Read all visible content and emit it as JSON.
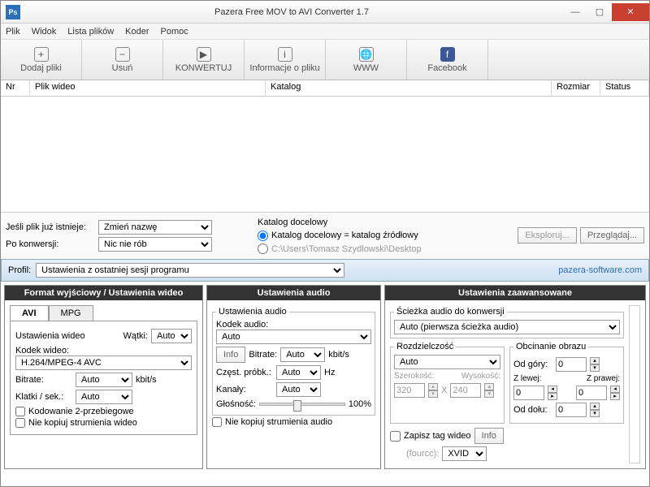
{
  "window": {
    "title": "Pazera Free MOV to AVI Converter 1.7"
  },
  "menu": [
    "Plik",
    "Widok",
    "Lista plików",
    "Koder",
    "Pomoc"
  ],
  "toolbar": [
    {
      "label": "Dodaj pliki",
      "icon": "+"
    },
    {
      "label": "Usuń",
      "icon": "−"
    },
    {
      "label": "KONWERTUJ",
      "icon": "▶"
    },
    {
      "label": "Informacje o pliku",
      "icon": "i"
    },
    {
      "label": "WWW",
      "icon": "🌐"
    },
    {
      "label": "Facebook",
      "icon": "f"
    }
  ],
  "columns": {
    "nr": "Nr",
    "plik": "Plik wideo",
    "katalog": "Katalog",
    "rozmiar": "Rozmiar",
    "status": "Status"
  },
  "opts": {
    "exists_label": "Jeśli plik już istnieje:",
    "exists_val": "Zmień nazwę",
    "after_label": "Po konwersji:",
    "after_val": "Nic nie rób",
    "dest_title": "Katalog docelowy",
    "dest_radio1": "Katalog docelowy = katalog źródłowy",
    "dest_radio2": "C:\\Users\\Tomasz Szydlowski\\Desktop",
    "eksploruj": "Eksploruj...",
    "przegladaj": "Przeglądaj..."
  },
  "profil": {
    "label": "Profil:",
    "value": "Ustawienia z ostatniej sesji programu",
    "link": "pazera-software.com"
  },
  "panel1": {
    "title": "Format wyjściowy / Ustawienia wideo",
    "tab_avi": "AVI",
    "tab_mpg": "MPG",
    "ust": "Ustawienia wideo",
    "watki": "Wątki:",
    "watki_v": "Auto",
    "kodek": "Kodek wideo:",
    "kodek_v": "H.264/MPEG-4 AVC",
    "bitrate": "Bitrate:",
    "bitrate_v": "Auto",
    "bitrate_u": "kbit/s",
    "fps": "Klatki / sek.:",
    "fps_v": "Auto",
    "chk1": "Kodowanie 2-przebiegowe",
    "chk2": "Nie kopiuj strumienia wideo"
  },
  "panel2": {
    "title": "Ustawienia audio",
    "ust": "Ustawienia audio",
    "kodek": "Kodek audio:",
    "kodek_v": "Auto",
    "info": "Info",
    "bitrate": "Bitrate:",
    "bitrate_v": "Auto",
    "bitrate_u": "kbit/s",
    "samp": "Częst. próbk.:",
    "samp_v": "Auto",
    "samp_u": "Hz",
    "kanaly": "Kanały:",
    "kanaly_v": "Auto",
    "glosnosc": "Głośność:",
    "glosnosc_v": "100%",
    "chk": "Nie kopiuj strumienia audio"
  },
  "panel3": {
    "title": "Ustawienia zaawansowane",
    "sciezka": "Ścieżka audio do konwersji",
    "sciezka_v": "Auto (pierwsza ścieżka audio)",
    "rozdz": "Rozdzielczość",
    "rozdz_v": "Auto",
    "szer": "Szerokość:",
    "szer_v": "320",
    "wys": "Wysokość:",
    "wys_v": "240",
    "x": "X",
    "obcin": "Obcinanie obrazu",
    "gora": "Od góry:",
    "lewa": "Z lewej:",
    "prawa": "Z prawej:",
    "dol": "Od dołu:",
    "zero": "0",
    "tag": "Zapisz tag wideo",
    "info": "Info",
    "fourcc": "(fourcc):",
    "fourcc_v": "XVID"
  }
}
